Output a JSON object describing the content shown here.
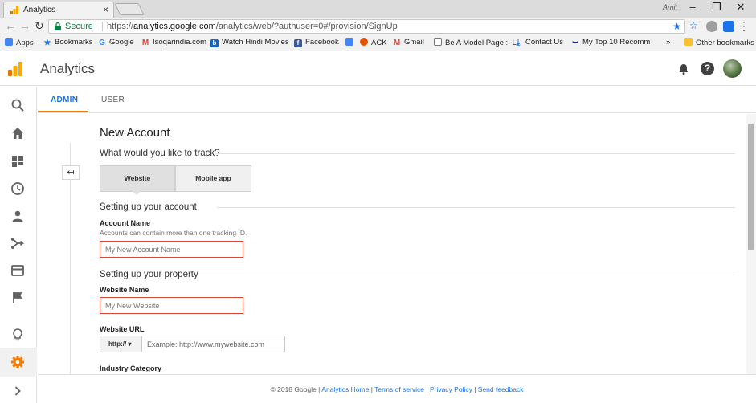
{
  "browser": {
    "tab_title": "Analytics",
    "profile_name": "Amit",
    "secure_label": "Secure",
    "url_prefix": "https://",
    "url_host": "analytics.google.com",
    "url_path": "/analytics/web/?authuser=0#/provision/SignUp",
    "bookmarks": {
      "apps": "Apps",
      "bookmarks": "Bookmarks",
      "google": "Google",
      "isoqar": "Isoqarindia.com",
      "hindi": "Watch Hindi Movies",
      "facebook": "Facebook",
      "ack": "ACK",
      "gmail": "Gmail",
      "model": "Be A Model Page :: L",
      "contact": "Contact Us",
      "top10": "My Top 10 Recomm",
      "more": "»",
      "other": "Other bookmarks"
    }
  },
  "header": {
    "title": "Analytics"
  },
  "admin_tabs": {
    "admin": "ADMIN",
    "user": "USER"
  },
  "form": {
    "heading": "New Account",
    "track_question": "What would you like to track?",
    "track_options": {
      "website": "Website",
      "mobile": "Mobile app"
    },
    "account_section": "Setting up your account",
    "account_name_label": "Account Name",
    "account_name_hint": "Accounts can contain more than one tracking ID.",
    "account_name_placeholder": "My New Account Name",
    "property_section": "Setting up your property",
    "website_name_label": "Website Name",
    "website_name_placeholder": "My New Website",
    "website_url_label": "Website URL",
    "protocol": "http://",
    "website_url_placeholder": "Example: http://www.mywebsite.com",
    "industry_label": "Industry Category"
  },
  "footer": {
    "copyright": "© 2018 Google",
    "analytics_home": "Analytics Home",
    "terms": "Terms of service",
    "privacy": "Privacy Policy",
    "feedback": "Send feedback"
  },
  "colors": {
    "accent_blue": "#1a73e8",
    "ga_orange": "#f57c00",
    "error_red": "#db4437",
    "secure_green": "#0b8043"
  }
}
